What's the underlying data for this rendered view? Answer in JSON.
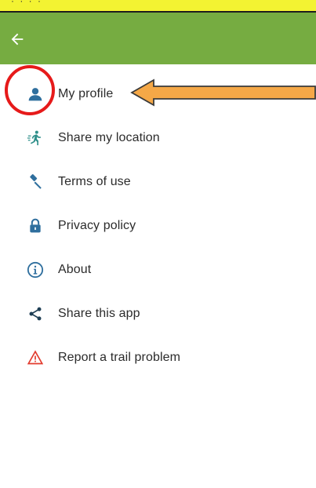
{
  "colors": {
    "status_bar": "#f3f332",
    "app_bar": "#76ac41",
    "icon_blue": "#2f6f9e",
    "warning_red": "#e23b2e",
    "annotation_circle": "#e61a1a",
    "annotation_arrow": "#f5a847"
  },
  "header": {
    "back_icon": "arrow-left-icon"
  },
  "menu": {
    "items": [
      {
        "label": "My profile",
        "icon": "person-icon"
      },
      {
        "label": "Share my location",
        "icon": "running-person-icon"
      },
      {
        "label": "Terms of use",
        "icon": "gavel-icon"
      },
      {
        "label": "Privacy policy",
        "icon": "lock-icon"
      },
      {
        "label": "About",
        "icon": "info-icon"
      },
      {
        "label": "Share this app",
        "icon": "share-icon"
      },
      {
        "label": "Report a trail problem",
        "icon": "warning-icon"
      }
    ]
  }
}
